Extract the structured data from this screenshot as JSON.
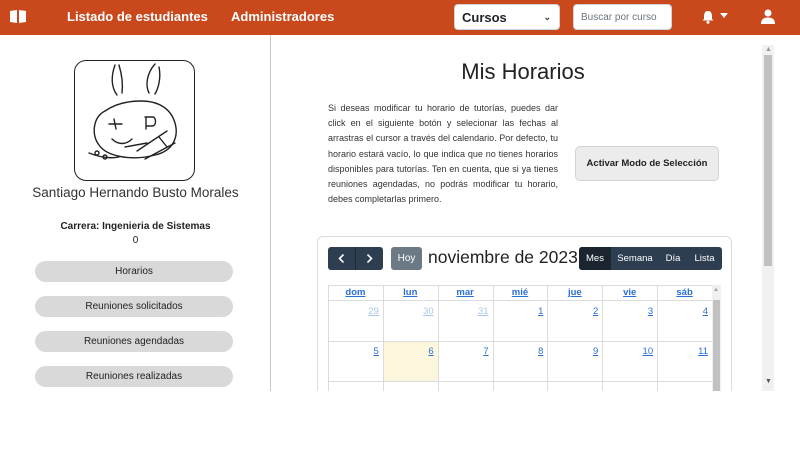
{
  "navbar": {
    "students_link": "Listado de estudiantes",
    "admins_link": "Administradores",
    "courses_select": "Cursos",
    "search_placeholder": "Buscar por curso",
    "color": "#c9491d"
  },
  "sidebar": {
    "student_name": "Santiago Hernando Busto Morales",
    "career": "Carrera: Ingenieria de Sistemas",
    "career_count": "0",
    "buttons": [
      "Horarios",
      "Reuniones solicitados",
      "Reuniones agendadas",
      "Reuniones realizadas"
    ]
  },
  "main": {
    "title": "Mis Horarios",
    "intro": "Si deseas modificar tu horario de tutorías, puedes dar click en el siguiente botón y selecionar las fechas al arrastras el cursor a través del calendario. Por defecto, tu horario estará vacío, lo que indica que no tienes horarios disponibles para tutorías. Ten en cuenta, que si ya tienes reuniones agendadas, no podrás modificar tu horario, debes completarlas primero.",
    "selection_mode_button": "Activar Modo de Selección"
  },
  "calendar": {
    "today_label": "Hoy",
    "title": "noviembre de 2023",
    "views": [
      "Mes",
      "Semana",
      "Día",
      "Lista"
    ],
    "active_view": "Mes",
    "weekdays": [
      "dom",
      "lun",
      "mar",
      "mié",
      "jue",
      "vie",
      "sáb"
    ],
    "weeks": [
      [
        {
          "d": "29",
          "other": true
        },
        {
          "d": "30",
          "other": true
        },
        {
          "d": "31",
          "other": true
        },
        {
          "d": "1"
        },
        {
          "d": "2"
        },
        {
          "d": "3"
        },
        {
          "d": "4"
        }
      ],
      [
        {
          "d": "5"
        },
        {
          "d": "6",
          "today": true
        },
        {
          "d": "7"
        },
        {
          "d": "8"
        },
        {
          "d": "9"
        },
        {
          "d": "10"
        },
        {
          "d": "11"
        }
      ]
    ],
    "header_color": "#2c3e50",
    "today_color": "#fcf6dc",
    "link_color": "#2a6fd6"
  }
}
